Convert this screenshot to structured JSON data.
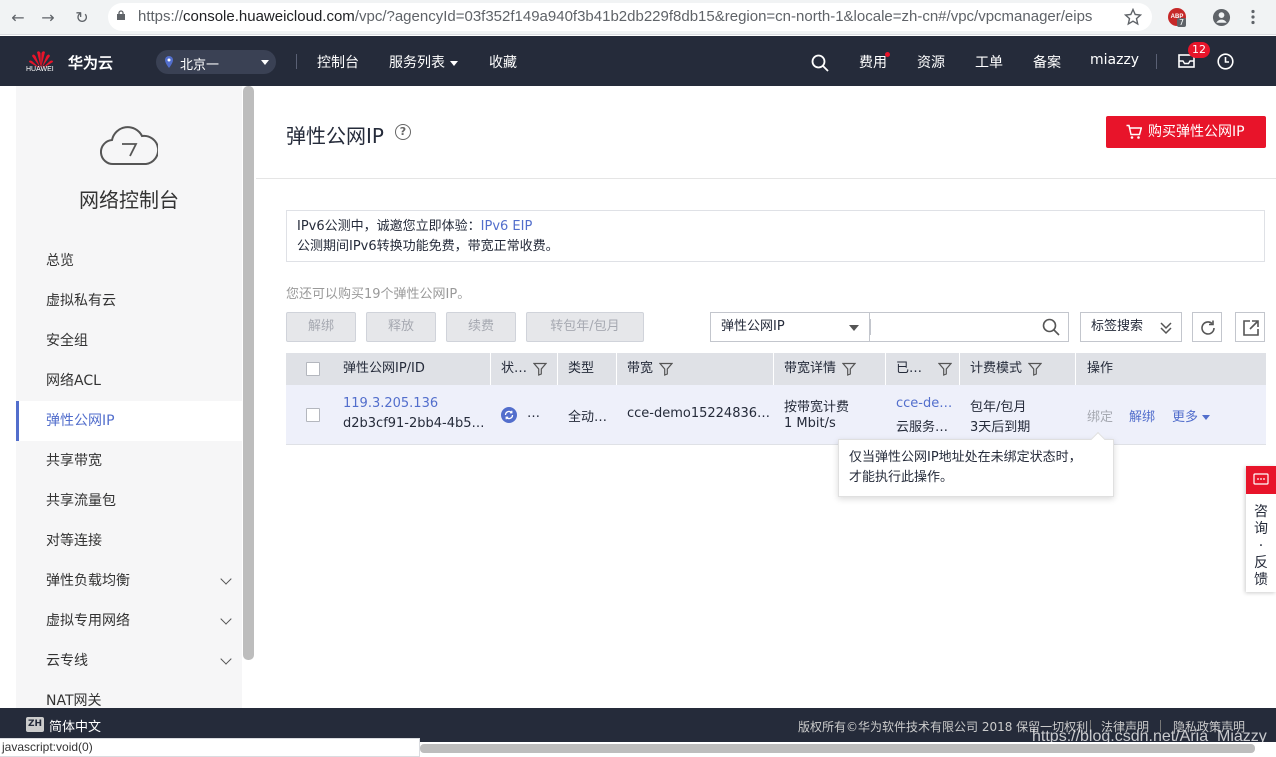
{
  "browser": {
    "url_scheme": "https://",
    "url_host": "console.huaweicloud.com",
    "url_path": "/vpc/?agencyId=03f352f149a940f3b41b2db229f8db15&region=cn-north-1&locale=zh-cn#/vpc/vpcmanager/eips",
    "ext_label": "ABP",
    "ext_count": "7"
  },
  "topnav": {
    "logo_text": "HUAWEI",
    "brand": "华为云",
    "region": "北京一",
    "links": [
      "控制台",
      "服务列表",
      "收藏"
    ],
    "right": [
      "费用",
      "资源",
      "工单",
      "备案",
      "miazzy"
    ],
    "msg_count": "12"
  },
  "sidebar": {
    "title": "网络控制台",
    "items": [
      {
        "label": "总览"
      },
      {
        "label": "虚拟私有云"
      },
      {
        "label": "安全组"
      },
      {
        "label": "网络ACL"
      },
      {
        "label": "弹性公网IP"
      },
      {
        "label": "共享带宽"
      },
      {
        "label": "共享流量包"
      },
      {
        "label": "对等连接"
      },
      {
        "label": "弹性负载均衡"
      },
      {
        "label": "虚拟专用网络"
      },
      {
        "label": "云专线"
      },
      {
        "label": "NAT网关"
      }
    ],
    "active_index": 4
  },
  "main": {
    "title": "弹性公网IP",
    "buy_button": "购买弹性公网IP",
    "notice_line1": "IPv6公测中，诚邀您立即体验：",
    "notice_link": "IPv6 EIP",
    "notice_line2": "公测期间IPv6转换功能免费，带宽正常收费。",
    "quota": "您还可以购买19个弹性公网IP。",
    "ops": [
      "解绑",
      "释放",
      "续费",
      "转包年/包月"
    ],
    "search_select": "弹性公网IP",
    "search_placeholder": "",
    "tag_search": "标签搜索"
  },
  "table": {
    "headers": [
      "弹性公网IP/ID",
      "状…",
      "类型",
      "带宽",
      "带宽详情",
      "已…",
      "计费模式",
      "操作"
    ],
    "row": {
      "ip": "119.3.205.136",
      "id": "d2b3cf91-2bb4-4b5…",
      "status": "…",
      "type": "全动…",
      "bandwidth": "cce-demo15224836…",
      "bw_detail1": "按带宽计费",
      "bw_detail2": "1 Mbit/s",
      "bound1": "cce-de…",
      "bound2": "云服务…",
      "billing1": "包年/包月",
      "billing2": "3天后到期",
      "action_bind": "绑定",
      "action_unbind": "解绑",
      "action_more": "更多"
    }
  },
  "tooltip": {
    "line1": "仅当弹性公网IP地址处在未绑定状态时，",
    "line2": "才能执行此操作。"
  },
  "feedback": {
    "chars": [
      "咨",
      "询",
      "·",
      "反",
      "馈"
    ]
  },
  "footer": {
    "lang_icon": "ZH",
    "lang": "简体中文",
    "copyright": "版权所有©华为软件技术有限公司 2018 保留一切权利",
    "legal": "法律声明",
    "privacy": "隐私政策声明"
  },
  "status_bar": "javascript:void(0)",
  "watermark": "https://blog.csdn.net/Aria_Miazzy",
  "colors": {
    "accent": "#526ecc",
    "brand_red": "#e8142a",
    "nav_bg": "#252b3a"
  }
}
